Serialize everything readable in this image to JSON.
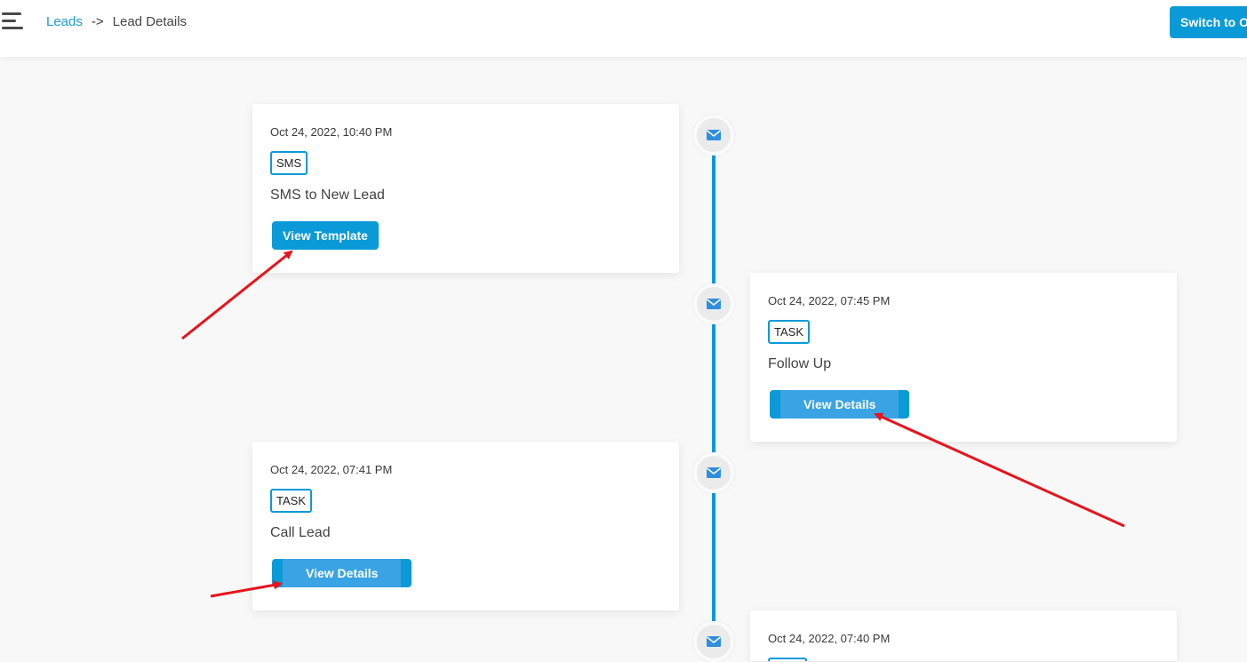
{
  "header": {
    "breadcrumb": {
      "link": "Leads",
      "separator": "->",
      "current": "Lead Details"
    },
    "switch_button": "Switch to O"
  },
  "timeline": {
    "items": [
      {
        "timestamp": "Oct 24, 2022, 10:40 PM",
        "type": "SMS",
        "description": "SMS to New Lead",
        "action": "View Template",
        "icon": "envelope-icon"
      },
      {
        "timestamp": "Oct 24, 2022, 07:45 PM",
        "type": "TASK",
        "description": "Follow Up",
        "action": "View Details",
        "icon": "envelope-icon"
      },
      {
        "timestamp": "Oct 24, 2022, 07:41 PM",
        "type": "TASK",
        "description": "Call Lead",
        "action": "View Details",
        "icon": "envelope-icon"
      },
      {
        "timestamp": "Oct 24, 2022, 07:40 PM",
        "type": "",
        "description": "",
        "action": "",
        "icon": "envelope-icon"
      }
    ]
  },
  "colors": {
    "accent": "#0a9ad8",
    "annotation": "#e8141c"
  }
}
